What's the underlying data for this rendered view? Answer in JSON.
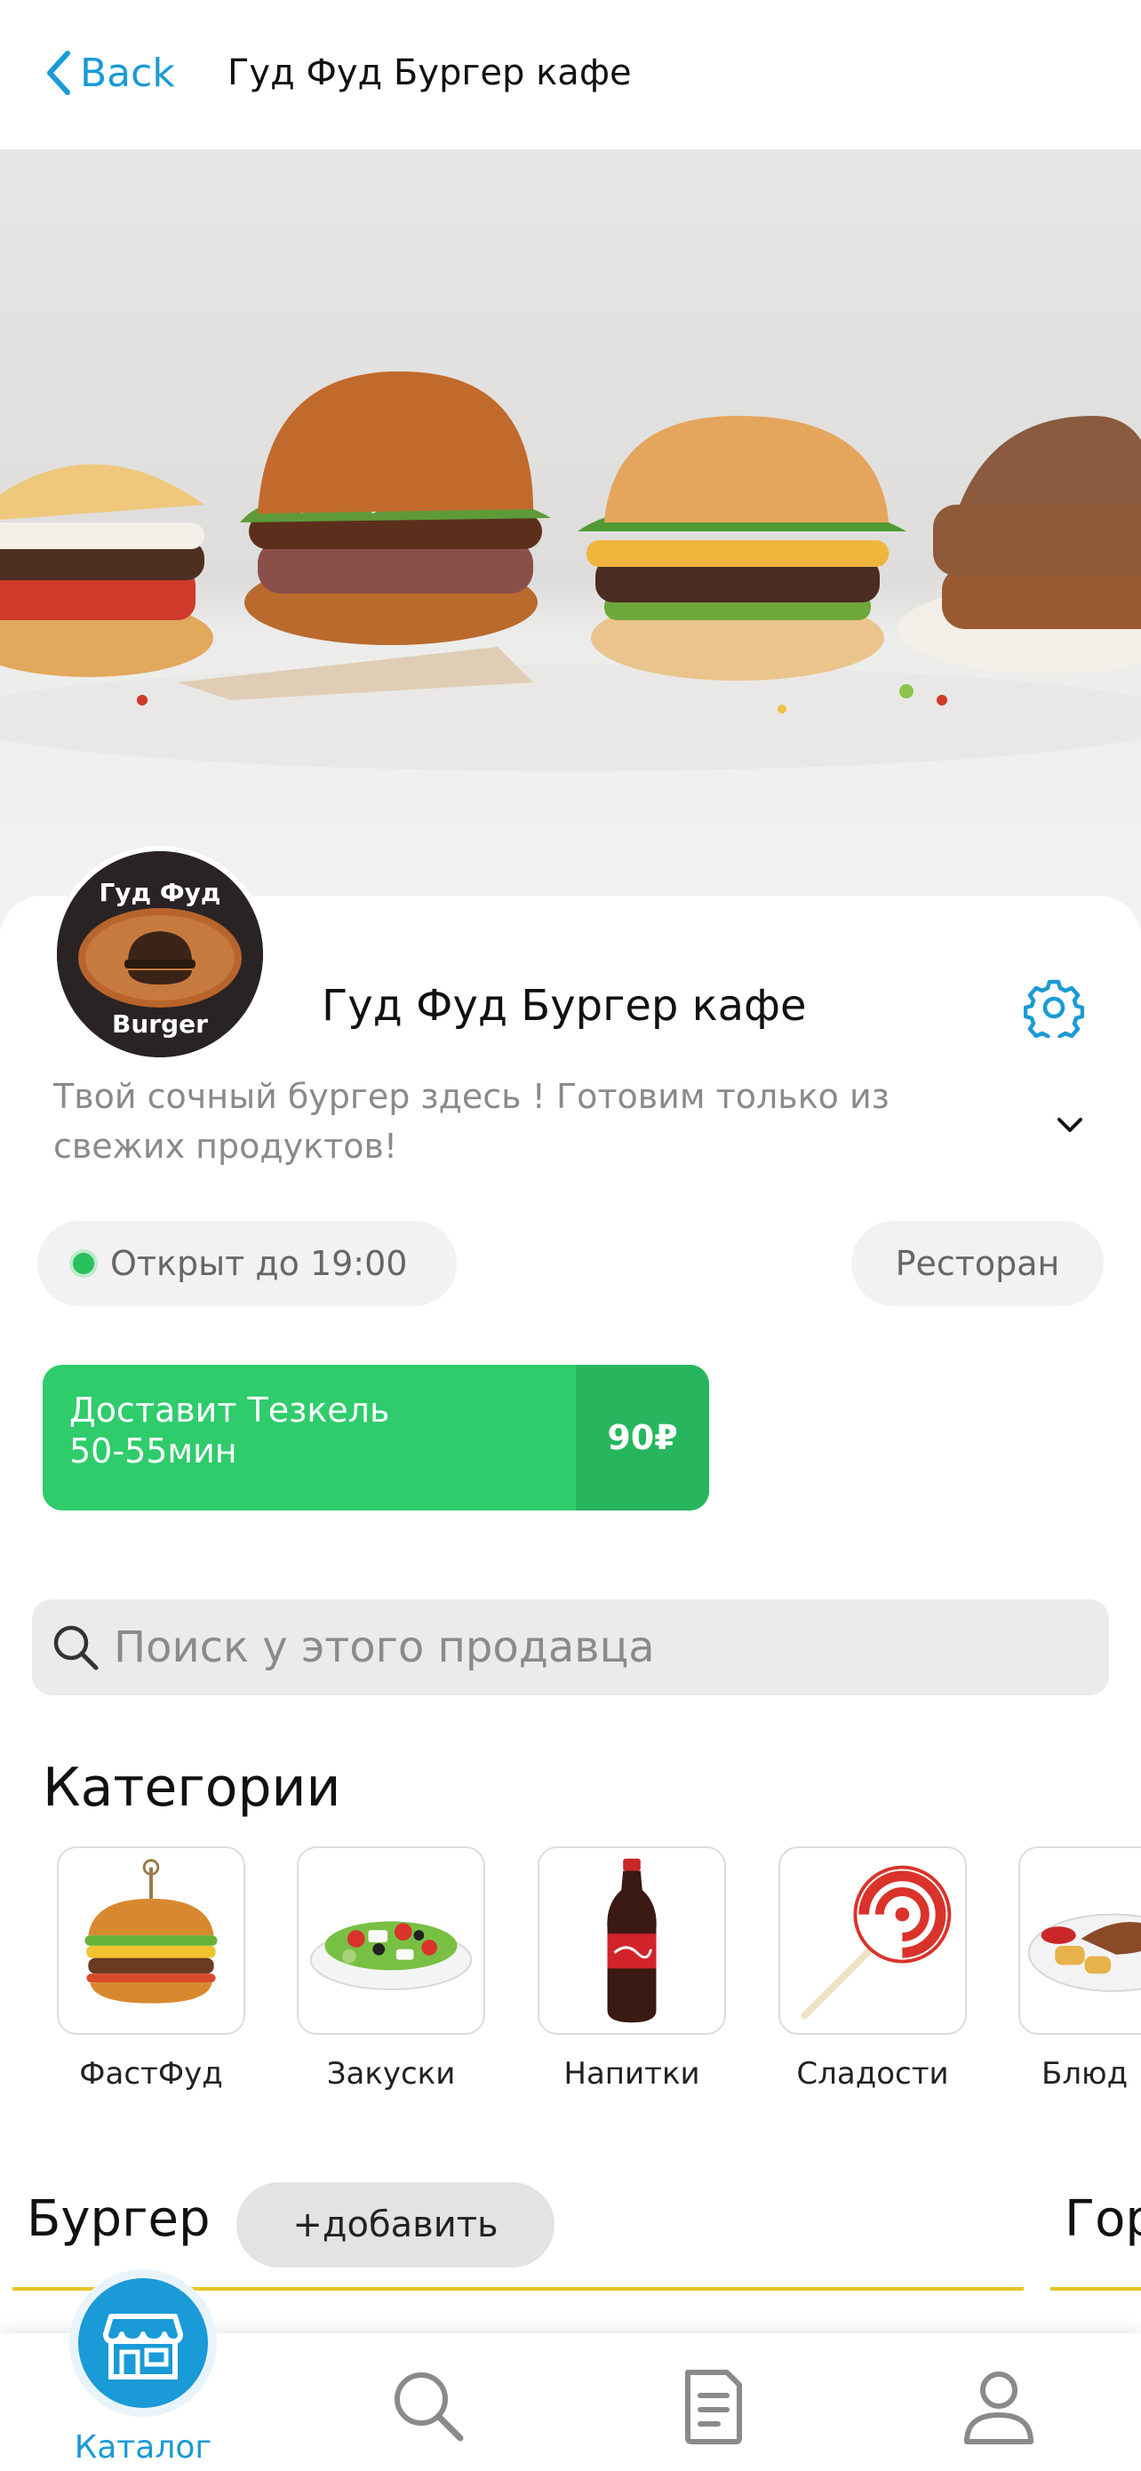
{
  "header": {
    "back_label": "Back",
    "title": "Гуд Фуд Бургер кафе"
  },
  "shop": {
    "logo_top_text": "Гуд Фуд",
    "logo_bottom_text": "Burger",
    "name": "Гуд Фуд Бургер кафе",
    "description": "Твой сочный бургер здесь ! Готовим только из свежих продуктов!",
    "status": "Открыт до 19:00",
    "type": "Ресторан"
  },
  "delivery": {
    "line1": "Доставит Тезкель",
    "line2": "50-55мин",
    "price": "90₽"
  },
  "search": {
    "placeholder": "Поиск у этого продавца"
  },
  "categories": {
    "title": "Категории",
    "items": [
      {
        "label": "ФастФуд",
        "icon": "burger-icon"
      },
      {
        "label": "Закуски",
        "icon": "salad-icon"
      },
      {
        "label": "Напитки",
        "icon": "cola-bottle-icon"
      },
      {
        "label": "Сладости",
        "icon": "lollipop-icon"
      },
      {
        "label": "Блюд",
        "icon": "dish-icon"
      }
    ]
  },
  "sections": {
    "current": "Бургер",
    "add_label": "+добавить",
    "next": "Гор"
  },
  "nav": {
    "items": [
      {
        "label": "Каталог",
        "icon": "storefront-icon",
        "active": true
      },
      {
        "label": "",
        "icon": "search-icon"
      },
      {
        "label": "",
        "icon": "orders-icon"
      },
      {
        "label": "",
        "icon": "profile-icon"
      }
    ]
  },
  "colors": {
    "accent": "#1a9ad6",
    "delivery_green": "#2ecc6b",
    "status_green": "#28c15b",
    "section_underline": "#e7c42b"
  }
}
